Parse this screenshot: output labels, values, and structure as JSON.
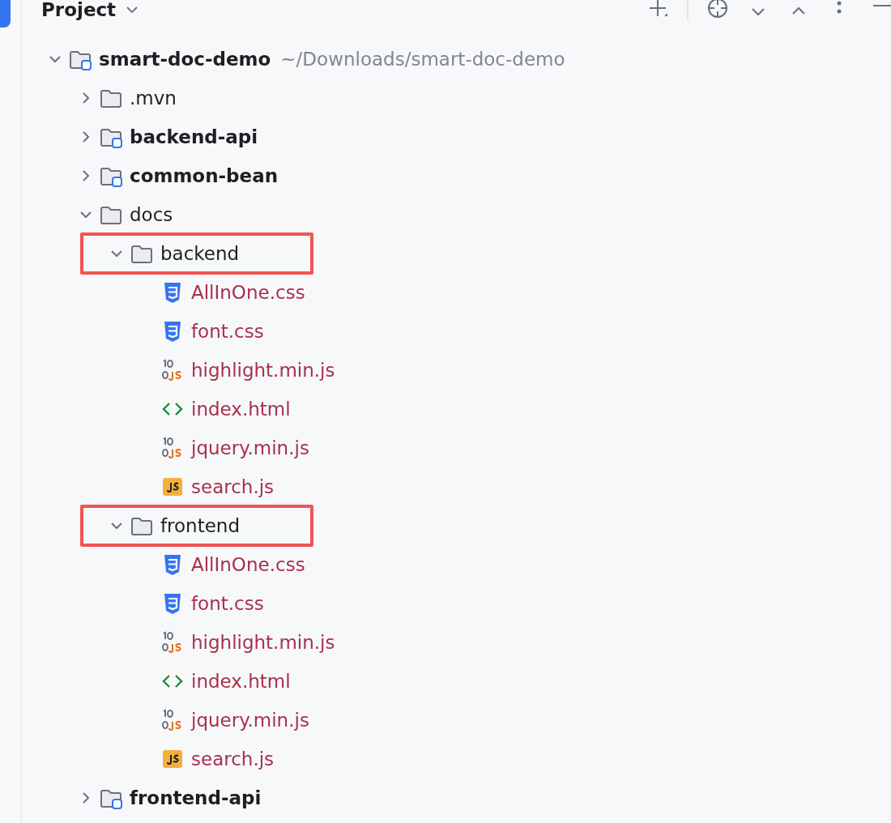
{
  "header": {
    "title": "Project"
  },
  "tree": [
    {
      "name": "smart-doc-demo",
      "kind": "module",
      "bold": true,
      "expanded": true,
      "path": "~/Downloads/smart-doc-demo",
      "highlighted": false,
      "children": [
        {
          "name": ".mvn",
          "kind": "folder",
          "bold": false,
          "expanded": false,
          "highlighted": false
        },
        {
          "name": "backend-api",
          "kind": "module",
          "bold": true,
          "expanded": false,
          "highlighted": false
        },
        {
          "name": "common-bean",
          "kind": "module",
          "bold": true,
          "expanded": false,
          "highlighted": false
        },
        {
          "name": "docs",
          "kind": "folder",
          "bold": false,
          "expanded": true,
          "highlighted": false,
          "children": [
            {
              "name": "backend",
              "kind": "folder",
              "bold": false,
              "expanded": true,
              "highlighted": true,
              "children": [
                {
                  "name": "AllInOne.css",
                  "kind": "css"
                },
                {
                  "name": "font.css",
                  "kind": "css"
                },
                {
                  "name": "highlight.min.js",
                  "kind": "minjs"
                },
                {
                  "name": "index.html",
                  "kind": "html"
                },
                {
                  "name": "jquery.min.js",
                  "kind": "minjs"
                },
                {
                  "name": "search.js",
                  "kind": "js"
                }
              ]
            },
            {
              "name": "frontend",
              "kind": "folder",
              "bold": false,
              "expanded": true,
              "highlighted": true,
              "children": [
                {
                  "name": "AllInOne.css",
                  "kind": "css"
                },
                {
                  "name": "font.css",
                  "kind": "css"
                },
                {
                  "name": "highlight.min.js",
                  "kind": "minjs"
                },
                {
                  "name": "index.html",
                  "kind": "html"
                },
                {
                  "name": "jquery.min.js",
                  "kind": "minjs"
                },
                {
                  "name": "search.js",
                  "kind": "js"
                }
              ]
            }
          ]
        },
        {
          "name": "frontend-api",
          "kind": "module",
          "bold": true,
          "expanded": false,
          "highlighted": false
        }
      ]
    }
  ]
}
